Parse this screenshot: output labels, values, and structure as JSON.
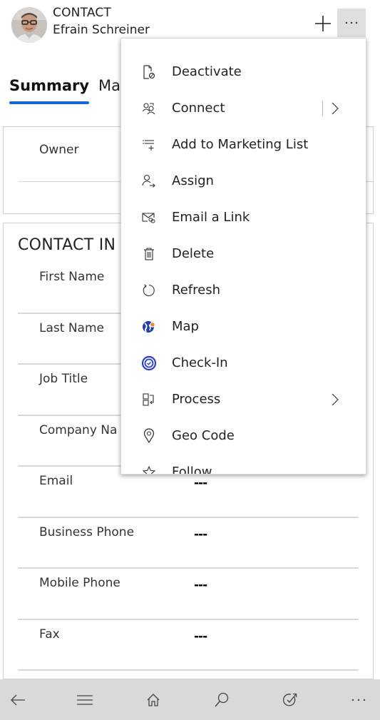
{
  "header": {
    "entity_type": "CONTACT",
    "record_name": "Efrain Schreiner",
    "avatar_icon": "person-photo",
    "add_icon": "plus-icon",
    "more_icon": "ellipsis-icon"
  },
  "tabs": [
    {
      "label": "Summary",
      "active": true
    },
    {
      "label": "Ma",
      "active": false
    }
  ],
  "owner_section": {
    "label": "Owner"
  },
  "contact_info": {
    "title": "CONTACT IN",
    "fields": [
      {
        "label": "First Name",
        "value": ""
      },
      {
        "label": "Last Name",
        "value": ""
      },
      {
        "label": "Job Title",
        "value": ""
      },
      {
        "label": "Company Na",
        "value": ""
      },
      {
        "label": "Email",
        "value": "---"
      },
      {
        "label": "Business Phone",
        "value": "---"
      },
      {
        "label": "Mobile Phone",
        "value": "---"
      },
      {
        "label": "Fax",
        "value": "---"
      }
    ]
  },
  "menu": {
    "items": [
      {
        "label": "Deactivate",
        "icon": "deactivate-icon",
        "submenu": false
      },
      {
        "label": "Connect",
        "icon": "connect-icon",
        "submenu": true,
        "separator": true
      },
      {
        "label": "Add to Marketing List",
        "icon": "add-list-icon",
        "submenu": false
      },
      {
        "label": "Assign",
        "icon": "assign-icon",
        "submenu": false
      },
      {
        "label": "Email a Link",
        "icon": "email-link-icon",
        "submenu": false
      },
      {
        "label": "Delete",
        "icon": "trash-icon",
        "submenu": false
      },
      {
        "label": "Refresh",
        "icon": "refresh-icon",
        "submenu": false
      },
      {
        "label": "Map",
        "icon": "map-globe-icon",
        "submenu": false
      },
      {
        "label": "Check-In",
        "icon": "check-in-icon",
        "submenu": false
      },
      {
        "label": "Process",
        "icon": "process-icon",
        "submenu": true
      },
      {
        "label": "Geo Code",
        "icon": "location-pin-icon",
        "submenu": false
      },
      {
        "label": "Follow",
        "icon": "star-icon",
        "submenu": false
      }
    ]
  },
  "bottom_nav": [
    {
      "name": "back",
      "icon": "back-arrow-icon"
    },
    {
      "name": "menu",
      "icon": "hamburger-icon"
    },
    {
      "name": "home",
      "icon": "home-icon"
    },
    {
      "name": "search",
      "icon": "search-icon"
    },
    {
      "name": "activities",
      "icon": "task-check-icon"
    },
    {
      "name": "more",
      "icon": "ellipsis-icon"
    }
  ],
  "colors": {
    "accent": "#1863dc",
    "bottom_bar": "#d9d9d9",
    "more_button_bg": "#dedede",
    "map_icon_blue": "#1d3fa8",
    "map_icon_orange": "#e8883a",
    "checkin_icon_blue": "#2b3fcf"
  }
}
